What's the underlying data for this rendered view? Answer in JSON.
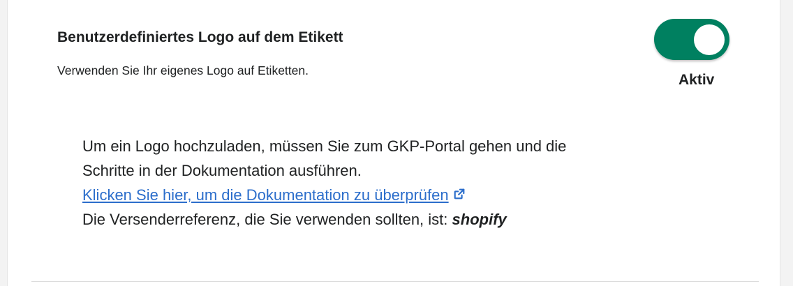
{
  "setting": {
    "title": "Benutzerdefiniertes Logo auf dem Etikett",
    "description": "Verwenden Sie Ihr eigenes Logo auf Etiketten.",
    "toggle": {
      "enabled": true,
      "status_label": "Aktiv",
      "color": "#008060"
    }
  },
  "info": {
    "line1": "Um ein Logo hochzuladen, müssen Sie zum GKP-Portal gehen und die",
    "line2": "Schritte in der Dokumentation ausführen.",
    "link_label": "Klicken Sie hier, um die Dokumentation zu überprüfen",
    "link_icon": "external-link-icon",
    "sender_ref_prefix": "Die Versenderreferenz, die Sie verwenden sollten, ist:",
    "sender_ref_value": "shopify"
  },
  "colors": {
    "link": "#2c6ecb",
    "text": "#202223"
  }
}
